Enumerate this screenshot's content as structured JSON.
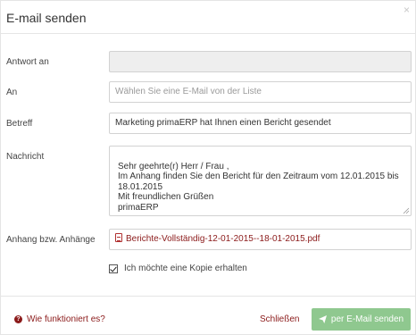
{
  "dialog": {
    "title": "E-mail senden",
    "close_glyph": "×"
  },
  "form": {
    "reply_to": {
      "label": "Antwort an",
      "value": ""
    },
    "to": {
      "label": "An",
      "placeholder": "Wählen Sie eine E-Mail von der Liste"
    },
    "subject": {
      "label": "Betreff",
      "value": "Marketing primaERP hat Ihnen einen Bericht gesendet"
    },
    "message": {
      "label": "Nachricht",
      "value": "Sehr geehrte(r) Herr / Frau ,\nIm Anhang finden Sie den Bericht für den Zeitraum vom 12.01.2015 bis 18.01.2015\nMit freundlichen Grüßen\nprimaERP"
    },
    "attachments": {
      "label": "Anhang bzw. Anhänge",
      "file": "Berichte-Vollständig-12-01-2015--18-01-2015.pdf"
    },
    "copy_checkbox": {
      "label": "Ich möchte eine Kopie erhalten",
      "checked": true
    }
  },
  "footer": {
    "help_link": "Wie funktioniert es?",
    "close_link": "Schließen",
    "send_button": "per E-Mail senden"
  },
  "icons": {
    "close": "close-icon",
    "pdf": "pdf-file-icon",
    "help": "question-circle-icon",
    "send": "paper-plane-icon"
  },
  "colors": {
    "link": "#8b1a1a",
    "send_button": "#8fc88f",
    "disabled_input": "#eeeeee"
  }
}
